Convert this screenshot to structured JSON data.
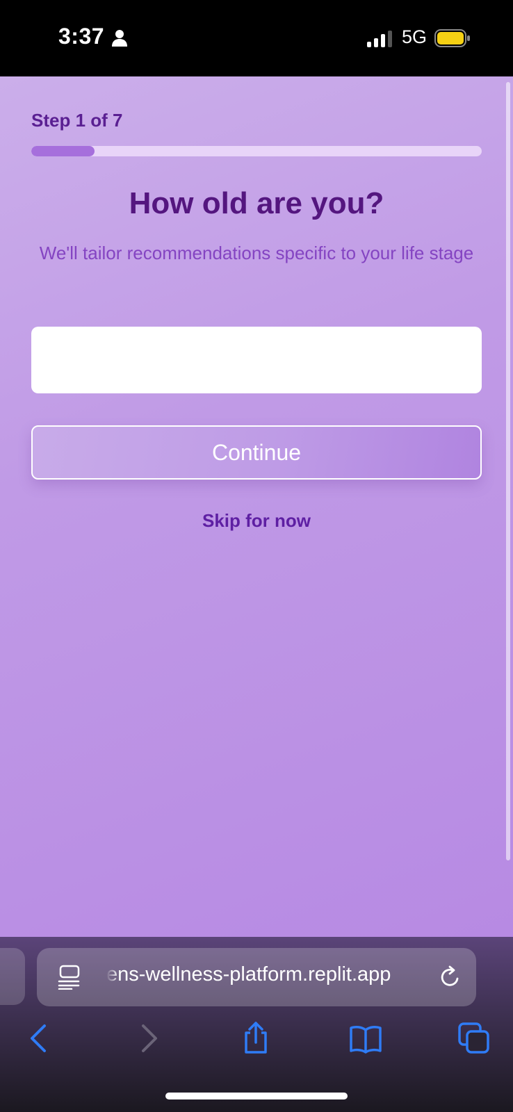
{
  "status_bar": {
    "time": "3:37",
    "network": "5G",
    "icons": [
      "person-icon",
      "signal-icon",
      "battery-icon"
    ],
    "battery_color": "#f5d014"
  },
  "onboarding": {
    "step_label": "Step 1 of 7",
    "progress": 0.14,
    "title": "How old are you?",
    "subtitle": "We'll tailor recommendations specific to your life stage",
    "age_input": {
      "value": "",
      "placeholder": ""
    },
    "continue_label": "Continue",
    "skip_label": "Skip for now"
  },
  "browser": {
    "url": "ens-wellness-platform.replit.app",
    "icons": [
      "reader-icon",
      "reload-icon",
      "back-icon",
      "forward-icon",
      "share-icon",
      "bookmarks-icon",
      "tabs-icon"
    ],
    "accent_color": "#2f7cf6"
  },
  "colors": {
    "title": "#54167f",
    "subtitle": "#8444c2",
    "background_start": "#cbaeea",
    "background_end": "#b78ae3"
  }
}
